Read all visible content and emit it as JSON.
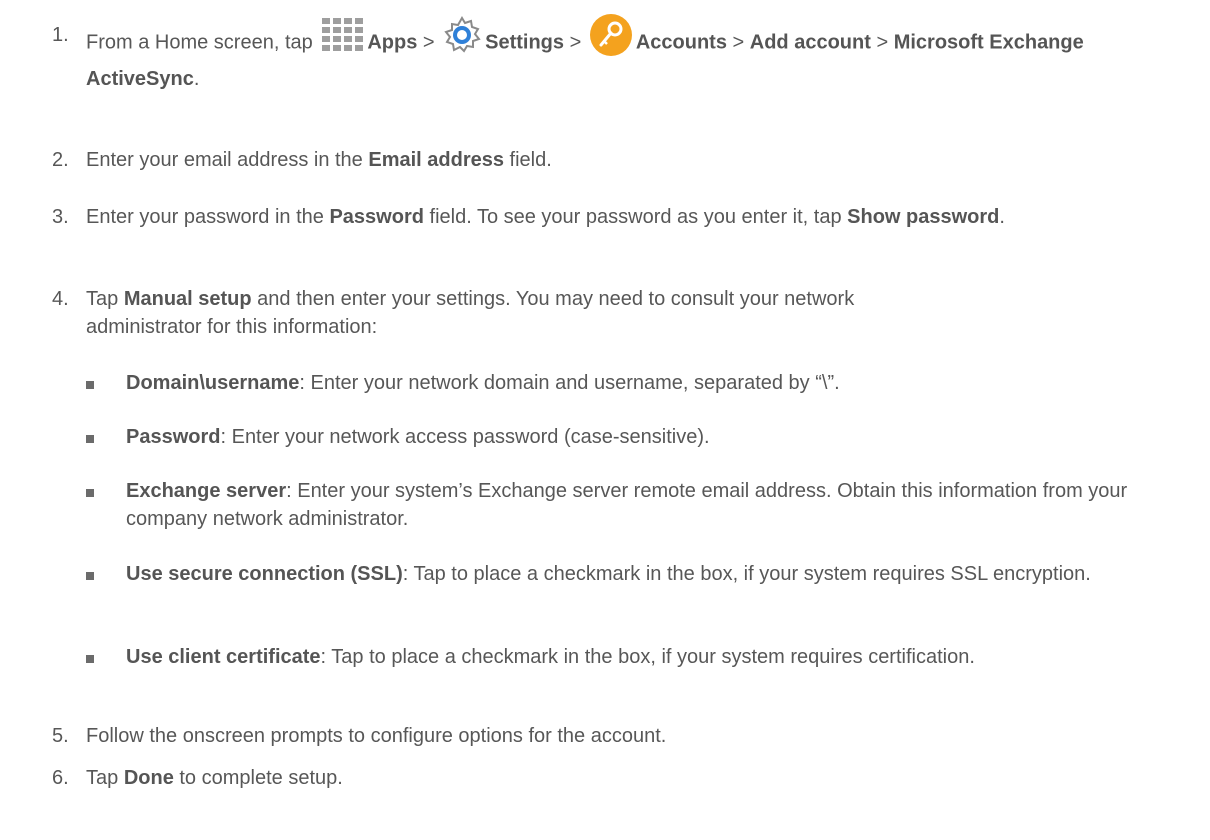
{
  "steps": [
    {
      "num": "1.",
      "t1": "From a Home screen, tap",
      "apps_label": "Apps",
      "sep1": " >",
      "settings_label": "Settings",
      "sep2": " >",
      "accounts_label": "Accounts",
      "sep3": " > ",
      "add_account": "Add account",
      "sep4": " >",
      "exchange": "Microsoft Exchange ActiveSync",
      "end": "."
    },
    {
      "num": "2.",
      "t1": "Enter your email address in the ",
      "b1": "Email address",
      "t2": " field."
    },
    {
      "num": "3.",
      "t1": "Enter your password in the ",
      "b1": "Password",
      "t2": " field. To see your password as you enter it, tap ",
      "b2": "Show password",
      "t3": "."
    },
    {
      "num": "4.",
      "t1": "Tap ",
      "b1": "Manual setup",
      "t2": " and then enter your settings. You may need to consult your network administrator for this information:"
    },
    {
      "num": "5.",
      "t1": "Follow the onscreen prompts to configure options for the account."
    },
    {
      "num": "6.",
      "t1": "Tap ",
      "b1": "Done",
      "t2": " to complete setup."
    }
  ],
  "bullets": [
    {
      "label": "Domain\\username",
      "text": ": Enter your network domain and username, separated by “\\”."
    },
    {
      "label": "Password",
      "text": ": Enter your network access password (case-sensitive)."
    },
    {
      "label": "Exchange server",
      "text": ": Enter your system’s Exchange server remote email address. Obtain this information from your company network administrator."
    },
    {
      "label": "Use secure connection (SSL)",
      "text": ": Tap to place a checkmark in the box, if your system requires SSL encryption."
    },
    {
      "label": "Use client certificate",
      "text": ": Tap to place a checkmark in the box, if your system requires certification."
    }
  ],
  "icons": {
    "apps": "apps-grid-icon",
    "settings": "settings-gear-icon",
    "accounts": "accounts-key-icon"
  },
  "colors": {
    "text": "#575757",
    "settings_blue": "#2f80d8",
    "accounts_orange": "#f4a21e"
  }
}
